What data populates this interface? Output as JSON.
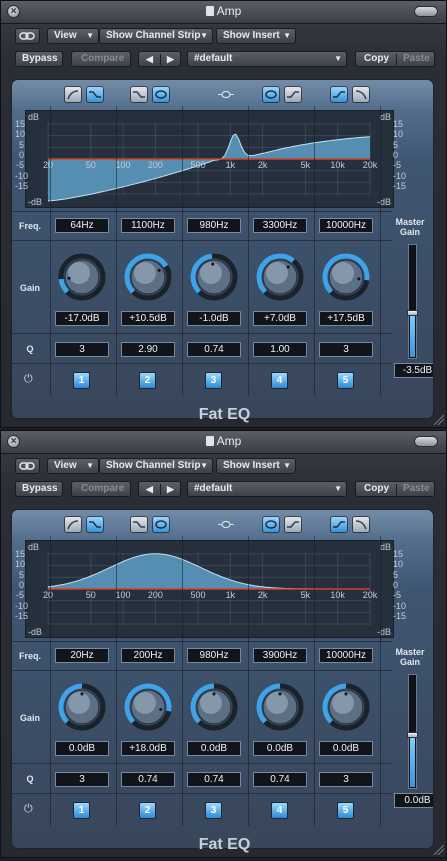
{
  "windows": [
    {
      "title": "Amp",
      "toolbar": {
        "view_label": "View",
        "channel_strip_label": "Show Channel Strip",
        "insert_label": "Show Insert",
        "bypass_label": "Bypass",
        "compare_label": "Compare",
        "prev_label": "◀",
        "next_label": "▶",
        "preset_label": "#default",
        "copy_label": "Copy",
        "paste_label": "Paste"
      },
      "plugin": {
        "name": "Fat EQ",
        "row_labels": {
          "freq": "Freq.",
          "gain": "Gain",
          "q": "Q"
        },
        "master_gain_label": [
          "Master",
          "Gain"
        ],
        "master_gain_value": "-3.5dB",
        "master_gain_level": 0.4,
        "graph": {
          "db_label": "dB",
          "neg_db_label": "-dB",
          "y_ticks": [
            "15",
            "10",
            "5",
            "0",
            "-5",
            "-10",
            "-15"
          ],
          "x_ticks": [
            "20",
            "50",
            "100",
            "200",
            "500",
            "1k",
            "2k",
            "5k",
            "10k",
            "20k"
          ]
        },
        "bands": [
          {
            "freq": "64Hz",
            "gain": "-17.0dB",
            "q": "3",
            "number": "1",
            "gain_db": -17.0
          },
          {
            "freq": "1100Hz",
            "gain": "+10.5dB",
            "q": "2.90",
            "number": "2",
            "gain_db": 10.5
          },
          {
            "freq": "980Hz",
            "gain": "-1.0dB",
            "q": "0.74",
            "number": "3",
            "gain_db": -1.0
          },
          {
            "freq": "3300Hz",
            "gain": "+7.0dB",
            "q": "1.00",
            "number": "4",
            "gain_db": 7.0
          },
          {
            "freq": "10000Hz",
            "gain": "+17.5dB",
            "q": "3",
            "number": "5",
            "gain_db": 17.5
          }
        ]
      }
    },
    {
      "title": "Amp",
      "toolbar": {
        "view_label": "View",
        "channel_strip_label": "Show Channel Strip",
        "insert_label": "Show Insert",
        "bypass_label": "Bypass",
        "compare_label": "Compare",
        "prev_label": "◀",
        "next_label": "▶",
        "preset_label": "#default",
        "copy_label": "Copy",
        "paste_label": "Paste"
      },
      "plugin": {
        "name": "Fat EQ",
        "row_labels": {
          "freq": "Freq.",
          "gain": "Gain",
          "q": "Q"
        },
        "master_gain_label": [
          "Master",
          "Gain"
        ],
        "master_gain_value": "0.0dB",
        "master_gain_level": 0.47,
        "graph": {
          "db_label": "dB",
          "neg_db_label": "-dB",
          "y_ticks": [
            "15",
            "10",
            "5",
            "0",
            "-5",
            "-10",
            "-15"
          ],
          "x_ticks": [
            "20",
            "50",
            "100",
            "200",
            "500",
            "1k",
            "2k",
            "5k",
            "10k",
            "20k"
          ]
        },
        "bands": [
          {
            "freq": "20Hz",
            "gain": "0.0dB",
            "q": "3",
            "number": "1",
            "gain_db": 0.0
          },
          {
            "freq": "200Hz",
            "gain": "+18.0dB",
            "q": "0.74",
            "number": "2",
            "gain_db": 18.0
          },
          {
            "freq": "980Hz",
            "gain": "0.0dB",
            "q": "0.74",
            "number": "3",
            "gain_db": 0.0
          },
          {
            "freq": "3900Hz",
            "gain": "0.0dB",
            "q": "0.74",
            "number": "4",
            "gain_db": 0.0
          },
          {
            "freq": "10000Hz",
            "gain": "0.0dB",
            "q": "3",
            "number": "5",
            "gain_db": 0.0
          }
        ]
      }
    }
  ],
  "icons": {
    "close": "close-icon",
    "link": "link-icon",
    "power": "power-icon",
    "dropdown": "chevron-down-icon"
  },
  "colors": {
    "accent": "#3fa3ea",
    "curve_fill": "#5f9fc6",
    "zero_line": "#d0402a",
    "panel": "#45607e"
  }
}
